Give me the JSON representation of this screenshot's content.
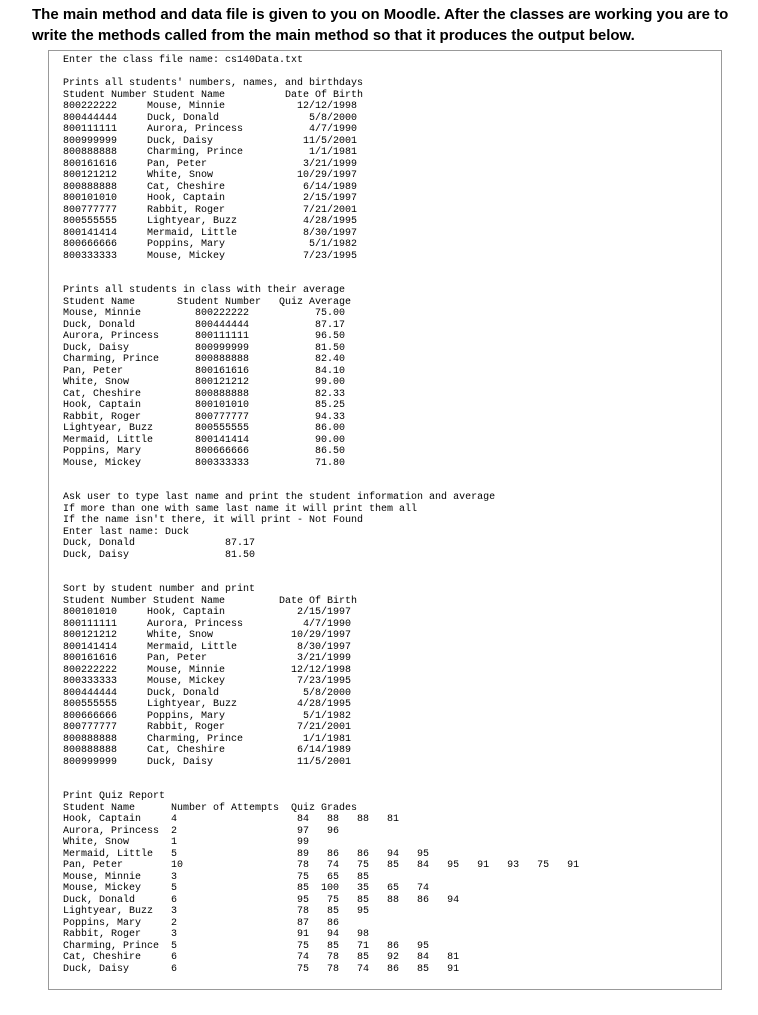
{
  "instructions": "The main method and data file is given to you on Moodle. After the classes are working you are to write the methods called from the main method so that it produces the output below.",
  "output": {
    "prompt": "Enter the class file name: cs140Data.txt",
    "section1": {
      "title": "Prints all students' numbers, names, and birthdays",
      "header": "Student Number Student Name          Date Of Birth",
      "rows": [
        "800222222     Mouse, Minnie            12/12/1998",
        "800444444     Duck, Donald               5/8/2000",
        "800111111     Aurora, Princess           4/7/1990",
        "800999999     Duck, Daisy               11/5/2001",
        "800888888     Charming, Prince           1/1/1981",
        "800161616     Pan, Peter                3/21/1999",
        "800121212     White, Snow              10/29/1997",
        "800888888     Cat, Cheshire             6/14/1989",
        "800101010     Hook, Captain             2/15/1997",
        "800777777     Rabbit, Roger             7/21/2001",
        "800555555     Lightyear, Buzz           4/28/1995",
        "800141414     Mermaid, Little           8/30/1997",
        "800666666     Poppins, Mary              5/1/1982",
        "800333333     Mouse, Mickey             7/23/1995"
      ]
    },
    "section2": {
      "title": "Prints all students in class with their average",
      "header": "Student Name       Student Number   Quiz Average",
      "rows": [
        "Mouse, Minnie         800222222           75.00",
        "Duck, Donald          800444444           87.17",
        "Aurora, Princess      800111111           96.50",
        "Duck, Daisy           800999999           81.50",
        "Charming, Prince      800888888           82.40",
        "Pan, Peter            800161616           84.10",
        "White, Snow           800121212           99.00",
        "Cat, Cheshire         800888888           82.33",
        "Hook, Captain         800101010           85.25",
        "Rabbit, Roger         800777777           94.33",
        "Lightyear, Buzz       800555555           86.00",
        "Mermaid, Little       800141414           90.00",
        "Poppins, Mary         800666666           86.50",
        "Mouse, Mickey         800333333           71.80"
      ]
    },
    "section3": {
      "lines": [
        "Ask user to type last name and print the student information and average",
        "If more than one with same last name it will print them all",
        "If the name isn't there, it will print - Not Found",
        "Enter last name: Duck",
        "Duck, Donald               87.17",
        "Duck, Daisy                81.50"
      ]
    },
    "section4": {
      "title": "Sort by student number and print",
      "header": "Student Number Student Name         Date Of Birth",
      "rows": [
        "800101010     Hook, Captain            2/15/1997",
        "800111111     Aurora, Princess          4/7/1990",
        "800121212     White, Snow             10/29/1997",
        "800141414     Mermaid, Little          8/30/1997",
        "800161616     Pan, Peter               3/21/1999",
        "800222222     Mouse, Minnie           12/12/1998",
        "800333333     Mouse, Mickey            7/23/1995",
        "800444444     Duck, Donald              5/8/2000",
        "800555555     Lightyear, Buzz          4/28/1995",
        "800666666     Poppins, Mary             5/1/1982",
        "800777777     Rabbit, Roger            7/21/2001",
        "800888888     Charming, Prince          1/1/1981",
        "800888888     Cat, Cheshire            6/14/1989",
        "800999999     Duck, Daisy              11/5/2001"
      ]
    },
    "section5": {
      "title": "Print Quiz Report",
      "header": "Student Name      Number of Attempts  Quiz Grades",
      "rows": [
        "Hook, Captain     4                    84   88   88   81",
        "Aurora, Princess  2                    97   96",
        "White, Snow       1                    99",
        "Mermaid, Little   5                    89   86   86   94   95",
        "Pan, Peter        10                   78   74   75   85   84   95   91   93   75   91",
        "Mouse, Minnie     3                    75   65   85",
        "Mouse, Mickey     5                    85  100   35   65   74",
        "Duck, Donald      6                    95   75   85   88   86   94",
        "Lightyear, Buzz   3                    78   85   95",
        "Poppins, Mary     2                    87   86",
        "Rabbit, Roger     3                    91   94   98",
        "Charming, Prince  5                    75   85   71   86   95",
        "Cat, Cheshire     6                    74   78   85   92   84   81",
        "Duck, Daisy       6                    75   78   74   86   85   91"
      ]
    }
  }
}
